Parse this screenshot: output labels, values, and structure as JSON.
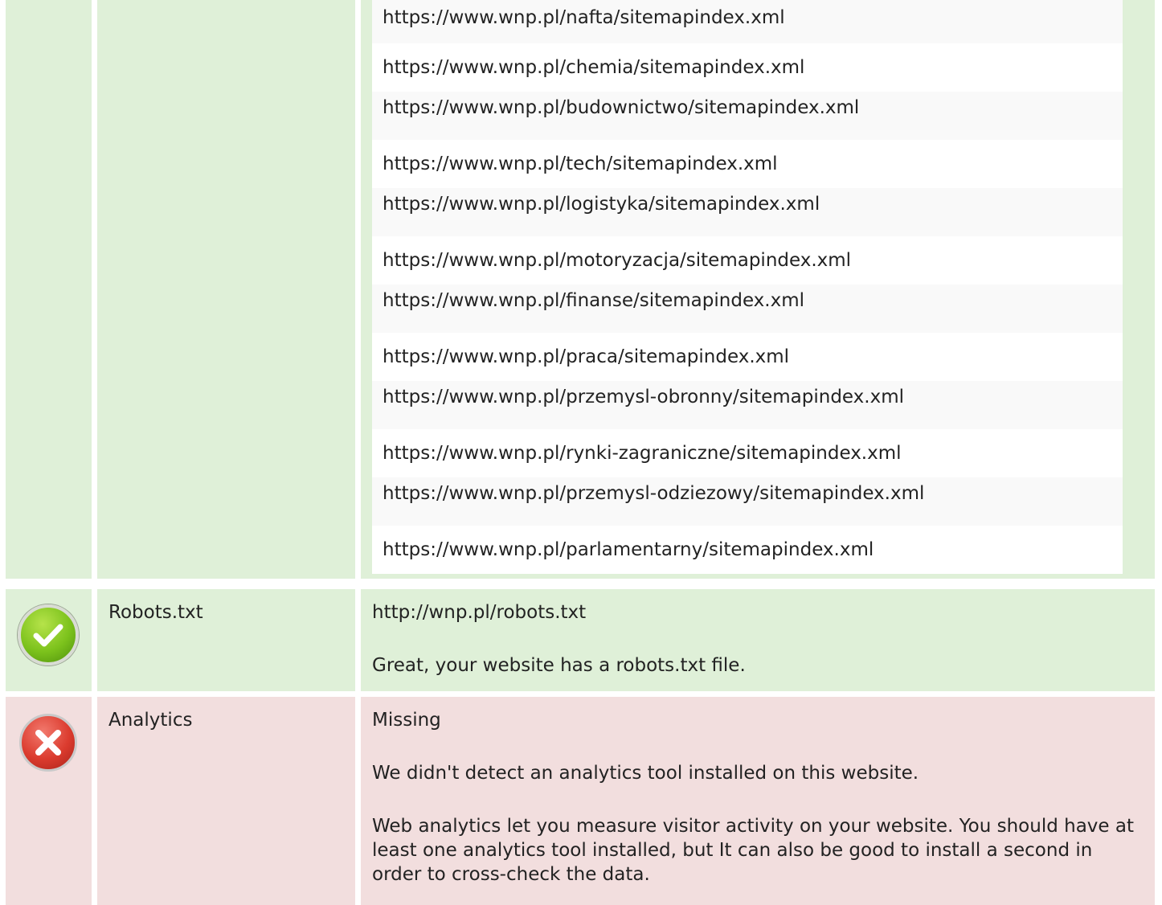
{
  "sitemaps": {
    "urls": [
      "https://www.wnp.pl/nafta/sitemapindex.xml",
      "https://www.wnp.pl/chemia/sitemapindex.xml",
      "https://www.wnp.pl/budownictwo/sitemapindex.xml",
      "https://www.wnp.pl/tech/sitemapindex.xml",
      "https://www.wnp.pl/logistyka/sitemapindex.xml",
      "https://www.wnp.pl/motoryzacja/sitemapindex.xml",
      "https://www.wnp.pl/finanse/sitemapindex.xml",
      "https://www.wnp.pl/praca/sitemapindex.xml",
      "https://www.wnp.pl/przemysl-obronny/sitemapindex.xml",
      "https://www.wnp.pl/rynki-zagraniczne/sitemapindex.xml",
      "https://www.wnp.pl/przemysl-odziezowy/sitemapindex.xml",
      "https://www.wnp.pl/parlamentarny/sitemapindex.xml"
    ]
  },
  "robots": {
    "status_icon": "check-icon",
    "status_color": "#7cc21c",
    "label": "Robots.txt",
    "url": "http://wnp.pl/robots.txt",
    "message": "Great, your website has a robots.txt file."
  },
  "analytics": {
    "status_icon": "error-x-icon",
    "status_color": "#db3b2e",
    "label": "Analytics",
    "value": "Missing",
    "message": "We didn't detect an analytics tool installed on this website.",
    "advice": "Web analytics let you measure visitor activity on your website. You should have at least one analytics tool installed, but It can also be good to install a second in order to cross-check the data."
  },
  "colors": {
    "pass_background": "#dff0d8",
    "fail_background": "#f2dede"
  }
}
